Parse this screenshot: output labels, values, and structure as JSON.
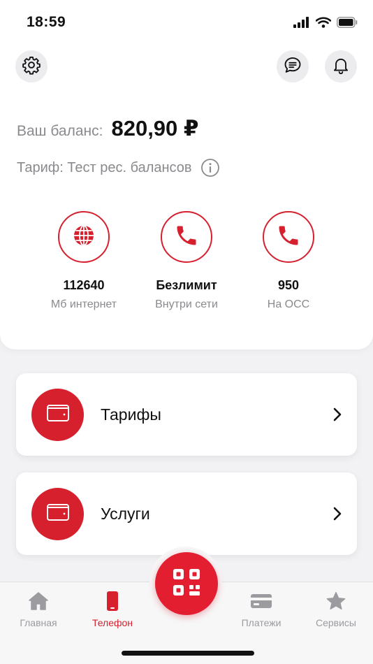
{
  "status_bar": {
    "time": "18:59"
  },
  "balance": {
    "label": "Ваш баланс:",
    "value": "820,90 ₽"
  },
  "tariff": {
    "label": "Тариф: Тест рес. балансов"
  },
  "stats": [
    {
      "value": "112640",
      "label": "Мб интернет",
      "icon": "globe-icon"
    },
    {
      "value": "Безлимит",
      "label": "Внутри сети",
      "icon": "phone-icon"
    },
    {
      "value": "950",
      "label": "На ОСС",
      "icon": "phone-icon"
    }
  ],
  "menu": [
    {
      "label": "Тарифы",
      "icon": "wallet-icon"
    },
    {
      "label": "Услуги",
      "icon": "wallet-icon"
    }
  ],
  "tabs": [
    {
      "label": "Главная",
      "icon": "home-icon",
      "active": false
    },
    {
      "label": "Телефон",
      "icon": "phone-device-icon",
      "active": true
    },
    {
      "label": "Платежи",
      "icon": "card-icon",
      "active": false
    },
    {
      "label": "Сервисы",
      "icon": "star-icon",
      "active": false
    }
  ],
  "colors": {
    "accent": "#d6202e",
    "muted": "#8a8a8e",
    "inactive_tab": "#9b9ba0"
  }
}
